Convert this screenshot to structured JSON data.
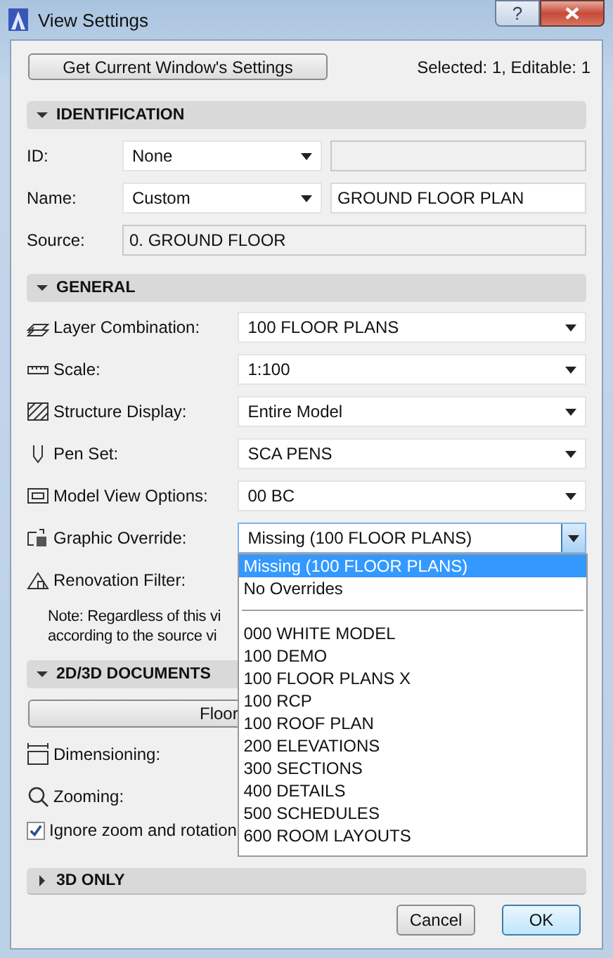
{
  "window": {
    "title": "View Settings",
    "help_button": "?"
  },
  "top": {
    "button": "Get Current Window's Settings",
    "status": "Selected: 1, Editable: 1"
  },
  "identification": {
    "title": "IDENTIFICATION",
    "expanded": true,
    "id": {
      "label": "ID:",
      "value": "None"
    },
    "name": {
      "label": "Name:",
      "value": "Custom",
      "text": "GROUND FLOOR PLAN"
    },
    "source": {
      "label": "Source:",
      "value": "0. GROUND FLOOR"
    }
  },
  "general": {
    "title": "GENERAL",
    "expanded": true,
    "rows": [
      {
        "label": "Layer Combination:",
        "value": "100 FLOOR PLANS",
        "open": false
      },
      {
        "label": "Scale:",
        "value": "1:100",
        "open": false
      },
      {
        "label": "Structure Display:",
        "value": "Entire Model",
        "open": false
      },
      {
        "label": "Pen Set:",
        "value": "SCA PENS",
        "open": false
      },
      {
        "label": "Model View Options:",
        "value": "00 BC",
        "open": false
      },
      {
        "label": "Graphic Override:",
        "value": "Missing (100 FLOOR PLANS)",
        "open": true
      },
      {
        "label": "Renovation Filter:"
      }
    ],
    "note": [
      "Note: Regardless of this vi",
      "according to the source vi"
    ]
  },
  "menu": [
    {
      "kind": "option",
      "label": "Missing (100 FLOOR PLANS)",
      "selected": true
    },
    {
      "kind": "option",
      "label": "No Overrides",
      "selected": false
    },
    {
      "kind": "separator"
    },
    {
      "kind": "option",
      "label": "000 WHITE MODEL",
      "selected": false
    },
    {
      "kind": "option",
      "label": "100 DEMO",
      "selected": false
    },
    {
      "kind": "option",
      "label": "100 FLOOR PLANS X",
      "selected": false
    },
    {
      "kind": "option",
      "label": "100 RCP",
      "selected": false
    },
    {
      "kind": "option",
      "label": "100 ROOF PLAN",
      "selected": false
    },
    {
      "kind": "option",
      "label": "200 ELEVATIONS",
      "selected": false
    },
    {
      "kind": "option",
      "label": "300 SECTIONS",
      "selected": false
    },
    {
      "kind": "option",
      "label": "400 DETAILS",
      "selected": false
    },
    {
      "kind": "option",
      "label": "500 SCHEDULES",
      "selected": false
    },
    {
      "kind": "option",
      "label": "600 ROOM LAYOUTS",
      "selected": false
    }
  ],
  "documents": {
    "title": "2D/3D DOCUMENTS",
    "expanded": true,
    "button": "Floor",
    "rows": [
      {
        "label": "Dimensioning:"
      },
      {
        "label": "Zooming:"
      }
    ],
    "checkbox": {
      "label": "Ignore zoom and rotation",
      "checked": true
    }
  },
  "only3d": {
    "title": "3D ONLY",
    "expanded": false
  },
  "buttons": [
    {
      "label": "Cancel",
      "default": false
    },
    {
      "label": "OK",
      "default": true
    }
  ]
}
